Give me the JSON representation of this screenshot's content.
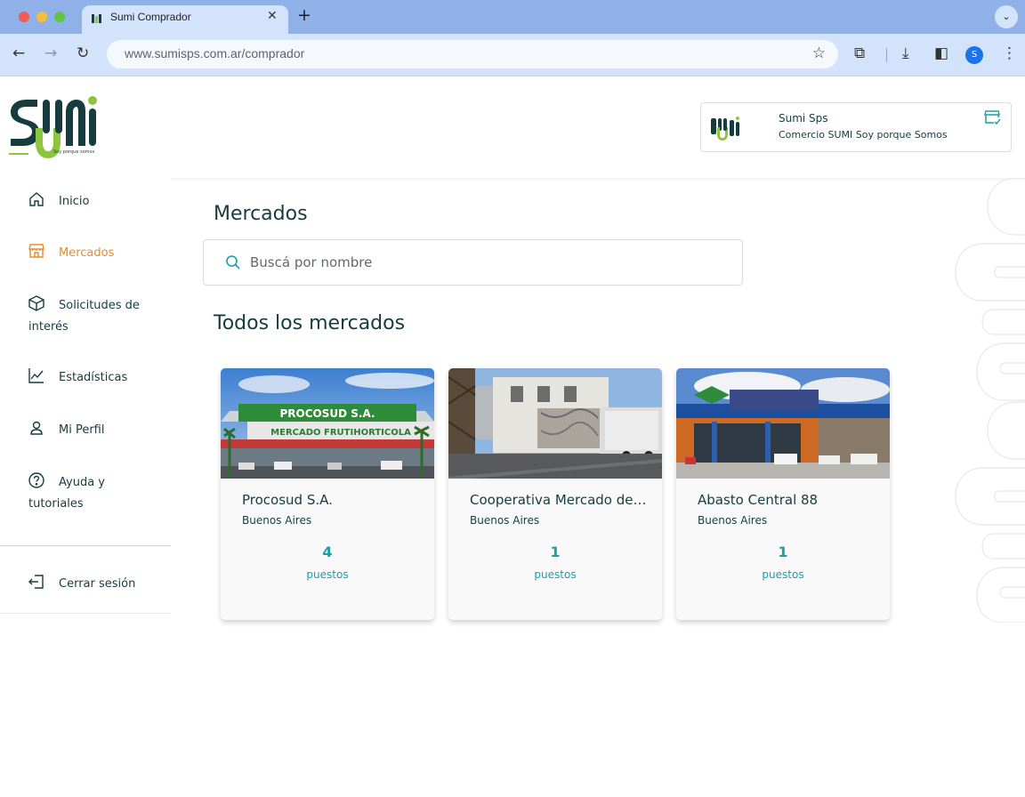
{
  "browser": {
    "tab_title": "Sumi Comprador",
    "url": "www.sumisps.com.ar/comprador",
    "profile_initial": "S"
  },
  "header": {
    "logo_tagline": "Soy porque somos",
    "store": {
      "name": "Sumi Sps",
      "description": "Comercio SUMI Soy porque Somos"
    }
  },
  "sidebar": {
    "items": [
      {
        "label": "Inicio",
        "icon": "home-icon"
      },
      {
        "label": "Mercados",
        "icon": "store-icon",
        "active": true
      },
      {
        "label": "Solicitudes de interés",
        "icon": "box-icon"
      },
      {
        "label": "Estadísticas",
        "icon": "chart-icon"
      },
      {
        "label": "Mi Perfil",
        "icon": "user-icon"
      },
      {
        "label": "Ayuda y tutoriales",
        "icon": "help-icon"
      }
    ],
    "logout": {
      "label": "Cerrar sesión",
      "icon": "logout-icon"
    }
  },
  "main": {
    "title": "Mercados",
    "search_placeholder": "Buscá por nombre",
    "section_title": "Todos los mercados",
    "markets": [
      {
        "name": "Procosud S.A.",
        "location": "Buenos Aires",
        "count": "4",
        "unit": "puestos"
      },
      {
        "name": "Cooperativa Mercado de Productores",
        "location": "Buenos Aires",
        "count": "1",
        "unit": "puestos"
      },
      {
        "name": "Abasto Central 88",
        "location": "Buenos Aires",
        "count": "1",
        "unit": "puestos"
      }
    ],
    "images": {
      "procosud_sign_1": "PROCOSUD S.A.",
      "procosud_sign_2": "MERCADO FRUTIHORTICOLA"
    }
  },
  "colors": {
    "brand_dark": "#163c40",
    "brand_green": "#8cc63f",
    "accent_orange": "#ec8a24",
    "teal": "#1aa0a8"
  }
}
